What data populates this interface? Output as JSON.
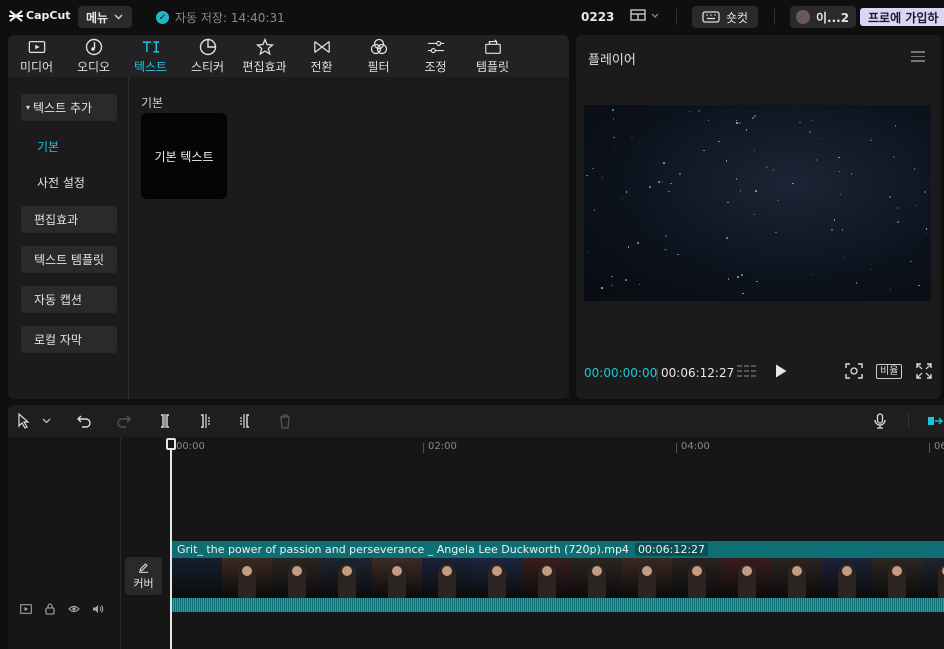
{
  "app": {
    "logo_text": "CapCut",
    "menu_label": "메뉴",
    "autosave_text": "자동 저장: 14:40:31",
    "project_name": "0223",
    "shortcut_label": "숏컷",
    "user_label": "이...2",
    "pro_label": "프로에 가입하"
  },
  "tabs": [
    {
      "label": "미디어",
      "icon": "media-icon"
    },
    {
      "label": "오디오",
      "icon": "audio-icon"
    },
    {
      "label": "텍스트",
      "icon": "text-icon",
      "active": true
    },
    {
      "label": "스티커",
      "icon": "sticker-icon"
    },
    {
      "label": "편집효과",
      "icon": "effects-icon"
    },
    {
      "label": "전환",
      "icon": "transition-icon"
    },
    {
      "label": "필터",
      "icon": "filter-icon"
    },
    {
      "label": "조정",
      "icon": "adjust-icon"
    },
    {
      "label": "템플릿",
      "icon": "template-icon"
    }
  ],
  "sidebar": {
    "header": "텍스트 추가",
    "subitems": [
      "기본",
      "사전 설정"
    ],
    "items": [
      "편집효과",
      "텍스트 템플릿",
      "자동 캡션",
      "로컬 자막"
    ]
  },
  "content": {
    "section_label": "기본",
    "card_label": "기본 텍스트"
  },
  "player": {
    "title": "플레이어",
    "current_time": "00:00:00:00",
    "total_time": "00:06:12:27",
    "ratio_label": "비율"
  },
  "timeline": {
    "ruler_labels": [
      "00:00",
      "02:00",
      "04:00",
      "06"
    ],
    "cover_label": "커버",
    "clip_name": "Grit_ the power of passion and perseverance _ Angela Lee Duckworth (720p).mp4",
    "clip_duration": "00:06:12:27"
  },
  "colors": {
    "accent": "#1fc7da",
    "clip": "#0d6e73",
    "pro_bg": "#d9d6f5"
  }
}
